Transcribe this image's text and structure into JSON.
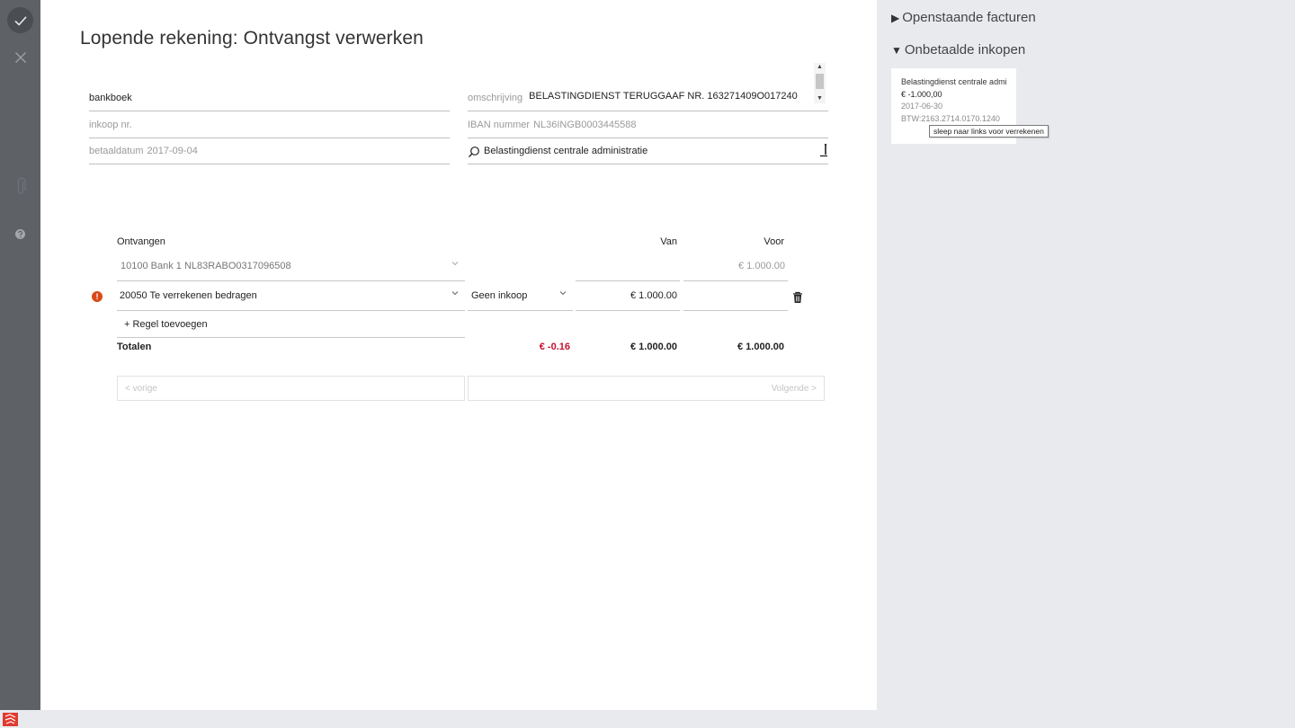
{
  "page": {
    "title": "Lopende rekening: Ontvangst verwerken"
  },
  "form": {
    "journal": "bankboek",
    "purchase_no_placeholder": "inkoop nr.",
    "payment_date_label": "betaaldatum",
    "payment_date": "2017-09-04",
    "description_label": "omschrijving",
    "description": "BELASTINGDIENST TERUGGAAF NR. 163271409O017240",
    "iban_label": "IBAN nummer",
    "iban": "NL36INGB0003445588",
    "relation": "Belastingdienst centrale administratie"
  },
  "table": {
    "headers": {
      "account": "Ontvangen",
      "from": "Van",
      "to": "Voor"
    },
    "rows": [
      {
        "account": "10100 Bank 1 NL83RABO0317096508",
        "purchase": "",
        "from": "",
        "to": "€ 1.000.00"
      },
      {
        "account": "20050 Te verrekenen bedragen",
        "purchase": "Geen inkoop",
        "from": "€ 1.000.00",
        "to": ""
      }
    ],
    "add_line": "+ Regel toevoegen",
    "totals_label": "Totalen",
    "totals_difference": "€ -0.16",
    "totals_from": "€ 1.000.00",
    "totals_to": "€ 1.000.00"
  },
  "navigation": {
    "previous": "< vorige",
    "next": "Volgende >"
  },
  "sidebar": {
    "open_invoices": "Openstaande facturen",
    "unpaid_purchases": "Onbetaalde inkopen",
    "card": {
      "name": "Belastingdienst centrale administratie",
      "amount": "€ -1.000,00",
      "date": "2017-06-30",
      "vat": "BTW:2163.2714.0170.1240"
    },
    "tooltip": "sleep naar links voor verrekenen"
  },
  "colors": {
    "rail": "#5e6166",
    "panel_bg": "#e9eaee",
    "error": "#d94a18",
    "negative": "#c8102e"
  },
  "icons": {
    "confirm": "check-icon",
    "cancel": "close-icon",
    "attach": "paperclip-icon",
    "help": "help-icon",
    "search": "search-icon",
    "relation_edit": "person-edit-icon",
    "chevron": "chevron-down-icon",
    "error": "error-icon",
    "delete": "trash-icon",
    "brand": "logo-icon"
  }
}
